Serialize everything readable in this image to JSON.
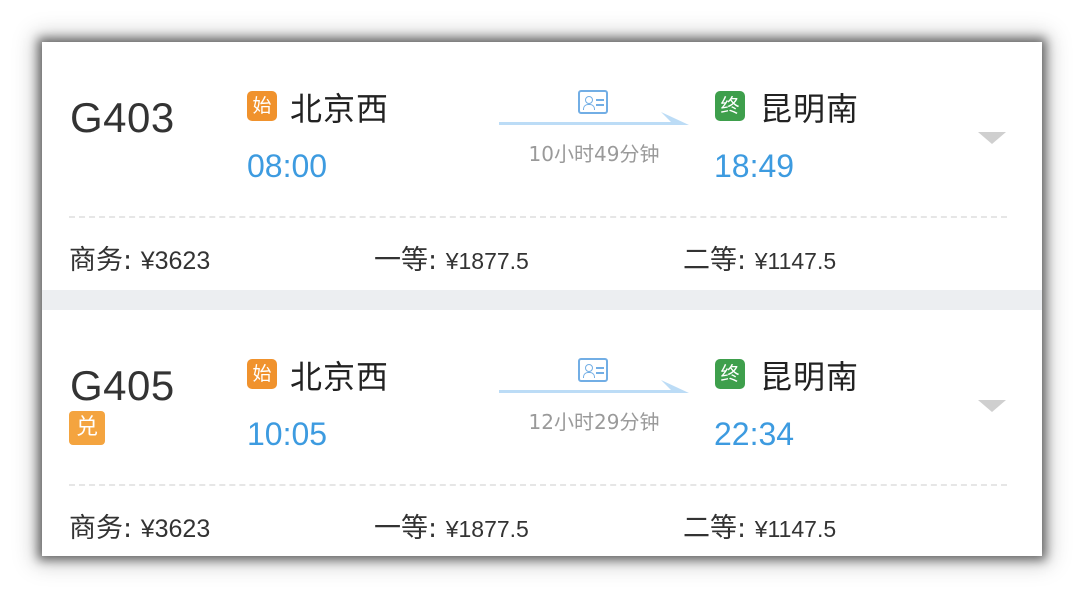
{
  "trains": [
    {
      "number": "G403",
      "exchange_badge": "",
      "from": {
        "badge": "始",
        "station": "北京西",
        "time": "08:00"
      },
      "to": {
        "badge": "终",
        "station": "昆明南",
        "time": "18:49"
      },
      "duration": "10小时49分钟",
      "prices": [
        {
          "label": "商务:",
          "value": "¥3623"
        },
        {
          "label": "一等:",
          "value": "¥1877.5"
        },
        {
          "label": "二等:",
          "value": "¥1147.5"
        }
      ]
    },
    {
      "number": "G405",
      "exchange_badge": "兑",
      "from": {
        "badge": "始",
        "station": "北京西",
        "time": "10:05"
      },
      "to": {
        "badge": "终",
        "station": "昆明南",
        "time": "22:34"
      },
      "duration": "12小时29分钟",
      "prices": [
        {
          "label": "商务:",
          "value": "¥3623"
        },
        {
          "label": "一等:",
          "value": "¥1877.5"
        },
        {
          "label": "二等:",
          "value": "¥1147.5"
        }
      ]
    }
  ],
  "icons": {
    "id_card": "id-card-icon",
    "arrow": "right-arrow-icon",
    "expand": "chevron-down-icon"
  },
  "colors": {
    "time_blue": "#3d9be0",
    "start_badge": "#f0922d",
    "end_badge": "#3e9f4c",
    "exchange_badge": "#f4a43f",
    "arrow_blue": "#bcdcf6"
  }
}
